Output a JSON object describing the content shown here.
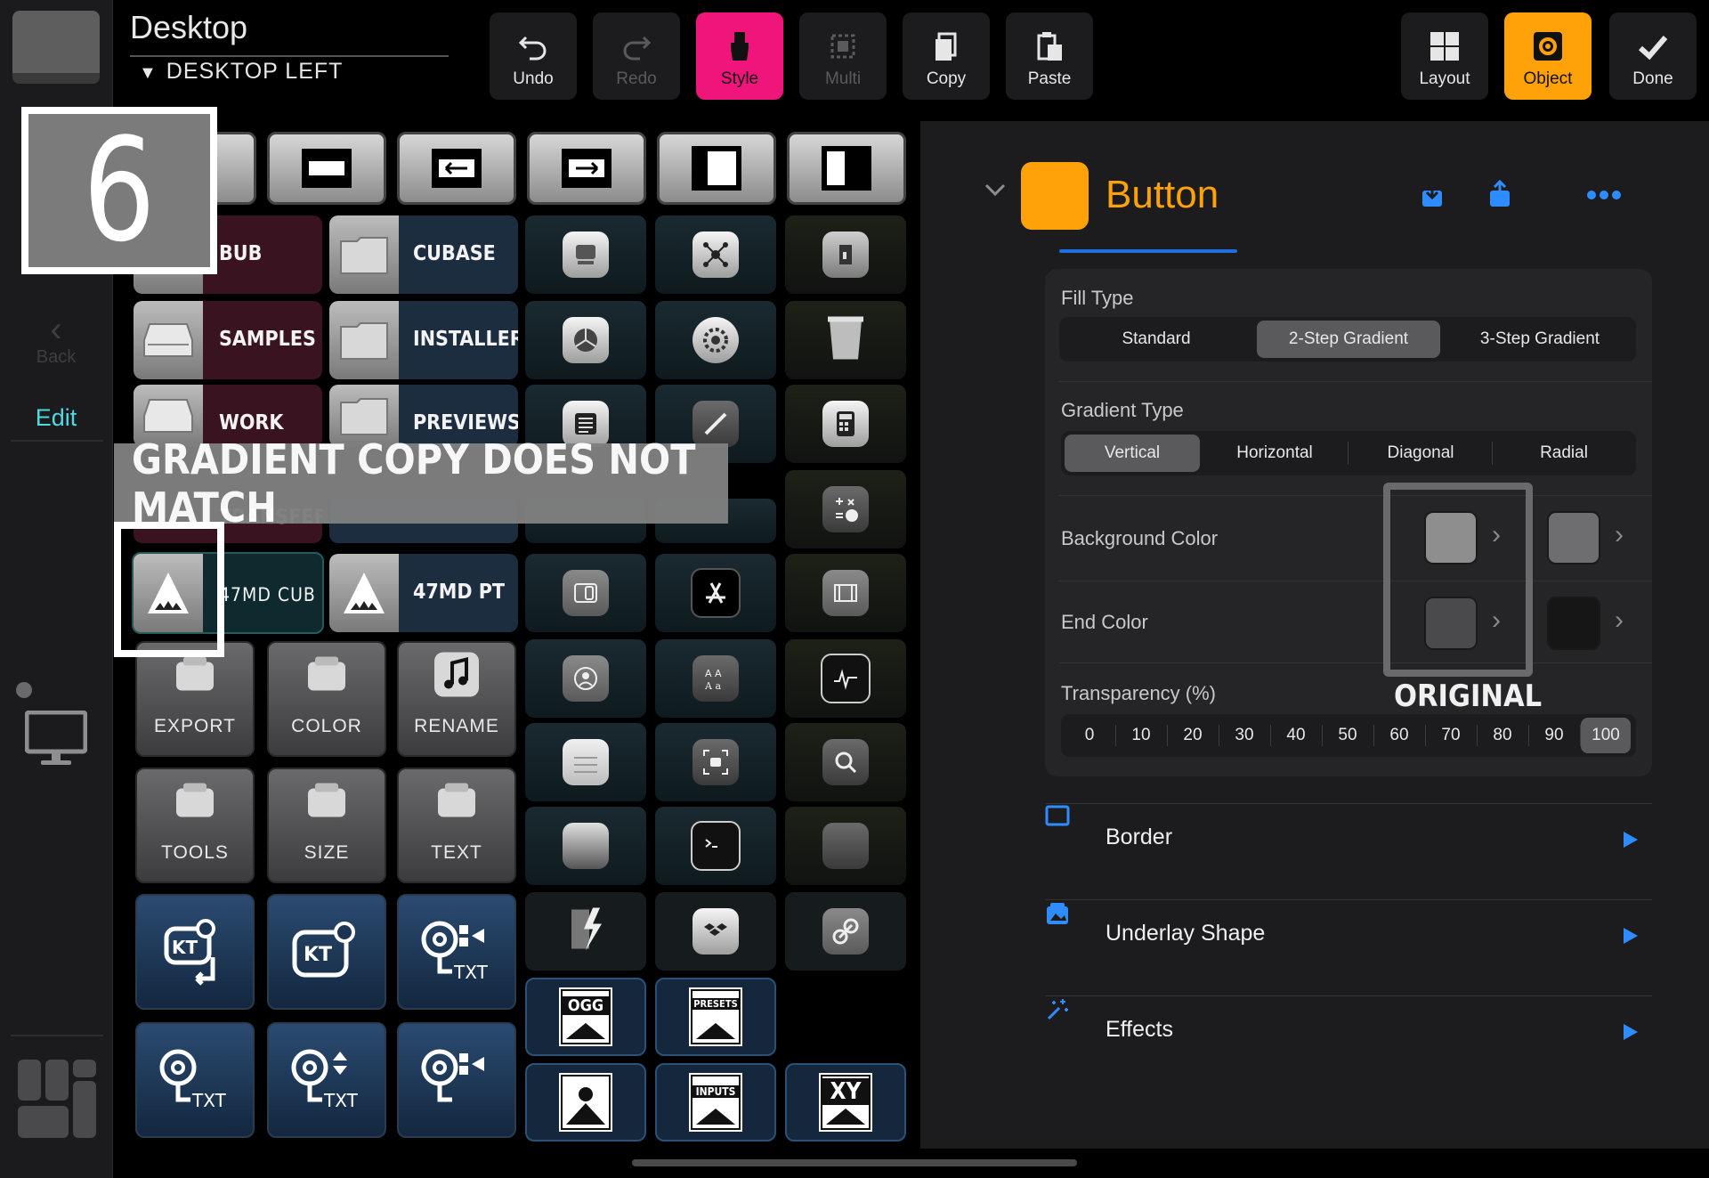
{
  "header": {
    "title": "Desktop",
    "page_select": "DESKTOP LEFT",
    "toolbar": {
      "undo": "Undo",
      "redo": "Redo",
      "style": "Style",
      "multi": "Multi",
      "copy": "Copy",
      "paste": "Paste",
      "layout": "Layout",
      "object": "Object",
      "done": "Done"
    }
  },
  "left_rail": {
    "back": "Back",
    "edit": "Edit"
  },
  "grid": {
    "labels": {
      "bub": "BUB",
      "cubase": "CUBASE",
      "samples": "SAMPLES",
      "installers": "INSTALLERS",
      "work": "WORK",
      "previews": "PREVIEWS",
      "transfer": "TRANSFER",
      "cub": "47MD CUB",
      "pt": "47MD PT",
      "export": "EXPORT",
      "color": "COLOR",
      "rename": "RENAME",
      "tools": "TOOLS",
      "size": "SIZE",
      "text": "TEXT",
      "txt": "TXT",
      "ogg": "OGG",
      "presets": "PRESETS",
      "inputs": "INPUTS",
      "xy": "XY"
    }
  },
  "annotations": {
    "step_number": "6",
    "banner": "GRADIENT COPY DOES NOT MATCH",
    "original_label": "ORIGINAL"
  },
  "panel": {
    "object_name": "Button",
    "object_color": "#FFA20A",
    "fill_type": {
      "label": "Fill Type",
      "options": [
        "Standard",
        "2-Step Gradient",
        "3-Step Gradient"
      ],
      "selected": "2-Step Gradient"
    },
    "gradient_type": {
      "label": "Gradient Type",
      "options": [
        "Vertical",
        "Horizontal",
        "Diagonal",
        "Radial"
      ],
      "selected": "Vertical"
    },
    "background_color": {
      "label": "Background Color",
      "original": "#8E8E8E",
      "copy": "#6E6E70"
    },
    "end_color": {
      "label": "End Color",
      "original": "#4A4A4C",
      "copy": "#161616"
    },
    "transparency": {
      "label": "Transparency (%)",
      "options": [
        "0",
        "10",
        "20",
        "30",
        "40",
        "50",
        "60",
        "70",
        "80",
        "90",
        "100"
      ],
      "selected": "100"
    },
    "sections": {
      "border": "Border",
      "underlay": "Underlay Shape",
      "effects": "Effects"
    }
  },
  "colors": {
    "accent_orange": "#FFA20A",
    "style_pink": "#F0157A",
    "link_blue": "#2F8CFF",
    "edit_teal": "#4FD8E0"
  }
}
